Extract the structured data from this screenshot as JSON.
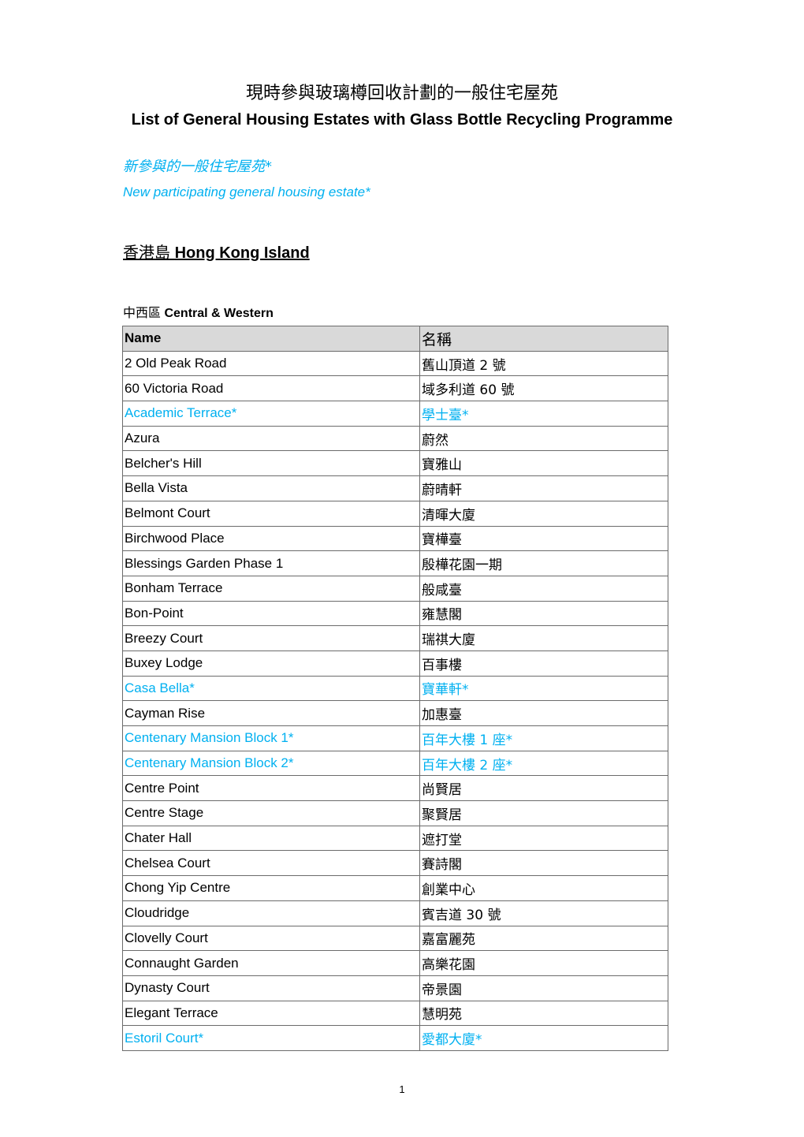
{
  "document": {
    "title_zh": "現時參與玻璃樽回收計劃的一般住宅屋苑",
    "title_en": "List of General Housing Estates with Glass Bottle Recycling Programme",
    "legend": {
      "zh": "新參與的一般住宅屋苑*",
      "en": "New participating general housing estate*",
      "color": "#00B0F0"
    },
    "region": {
      "zh": "香港島",
      "en": "Hong Kong Island"
    },
    "district": {
      "zh": "中西區",
      "en": "Central & Western"
    },
    "table": {
      "headers": [
        "Name",
        "名稱"
      ],
      "header_fill": "#D9D9D9",
      "rows": [
        {
          "name": "2 Old Peak Road",
          "name_zh": "舊山頂道 2 號",
          "new": false
        },
        {
          "name": "60 Victoria Road",
          "name_zh": "域多利道 60 號",
          "new": false
        },
        {
          "name": "Academic Terrace*",
          "name_zh": "學士臺*",
          "new": true
        },
        {
          "name": "Azura",
          "name_zh": "蔚然",
          "new": false
        },
        {
          "name": "Belcher's Hill",
          "name_zh": "寶雅山",
          "new": false
        },
        {
          "name": "Bella Vista",
          "name_zh": "蔚晴軒",
          "new": false
        },
        {
          "name": "Belmont Court",
          "name_zh": "清暉大廈",
          "new": false
        },
        {
          "name": "Birchwood Place",
          "name_zh": "寶樺臺",
          "new": false
        },
        {
          "name": "Blessings Garden Phase 1",
          "name_zh": "殷樺花園一期",
          "new": false
        },
        {
          "name": "Bonham Terrace",
          "name_zh": "般咸臺",
          "new": false
        },
        {
          "name": "Bon-Point",
          "name_zh": "雍慧閣",
          "new": false
        },
        {
          "name": "Breezy Court",
          "name_zh": "瑞祺大廈",
          "new": false
        },
        {
          "name": "Buxey Lodge",
          "name_zh": "百事樓",
          "new": false
        },
        {
          "name": "Casa Bella*",
          "name_zh": "寶華軒*",
          "new": true
        },
        {
          "name": "Cayman Rise",
          "name_zh": "加惠臺",
          "new": false
        },
        {
          "name": "Centenary Mansion Block 1*",
          "name_zh": "百年大樓 1 座*",
          "new": true
        },
        {
          "name": "Centenary Mansion Block 2*",
          "name_zh": "百年大樓 2 座*",
          "new": true
        },
        {
          "name": "Centre Point",
          "name_zh": "尚賢居",
          "new": false
        },
        {
          "name": "Centre Stage",
          "name_zh": "聚賢居",
          "new": false
        },
        {
          "name": "Chater Hall",
          "name_zh": "遮打堂",
          "new": false
        },
        {
          "name": "Chelsea Court",
          "name_zh": "賽詩閣",
          "new": false
        },
        {
          "name": "Chong Yip Centre",
          "name_zh": "創業中心",
          "new": false
        },
        {
          "name": "Cloudridge",
          "name_zh": "賓吉道 30 號",
          "new": false
        },
        {
          "name": "Clovelly Court",
          "name_zh": "嘉富麗苑",
          "new": false
        },
        {
          "name": "Connaught Garden",
          "name_zh": "高樂花園",
          "new": false
        },
        {
          "name": "Dynasty Court",
          "name_zh": "帝景園",
          "new": false
        },
        {
          "name": "Elegant Terrace",
          "name_zh": "慧明苑",
          "new": false
        },
        {
          "name": "Estoril Court*",
          "name_zh": "愛都大廈*",
          "new": true
        }
      ]
    },
    "page_number": "1"
  }
}
